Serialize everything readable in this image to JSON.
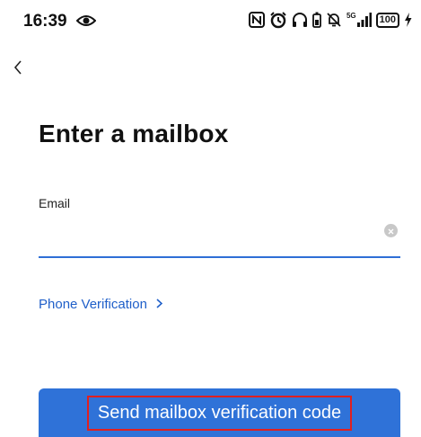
{
  "status_bar": {
    "time": "16:39",
    "network": "5G",
    "battery": "100"
  },
  "page": {
    "title": "Enter a mailbox"
  },
  "form": {
    "email_label": "Email",
    "email_value": "",
    "email_placeholder": ""
  },
  "links": {
    "phone_verification": "Phone Verification"
  },
  "actions": {
    "send_code": "Send mailbox verification code"
  },
  "colors": {
    "accent": "#2f72d8",
    "link": "#1f5fc9",
    "highlight_box": "#e02020"
  },
  "icons": [
    "eye-icon",
    "nfc-icon",
    "alarm-icon",
    "headphones-icon",
    "mute-icon",
    "signal-icon",
    "battery-icon",
    "charging-icon",
    "back-chevron-icon",
    "clear-icon",
    "chevron-right-icon"
  ]
}
